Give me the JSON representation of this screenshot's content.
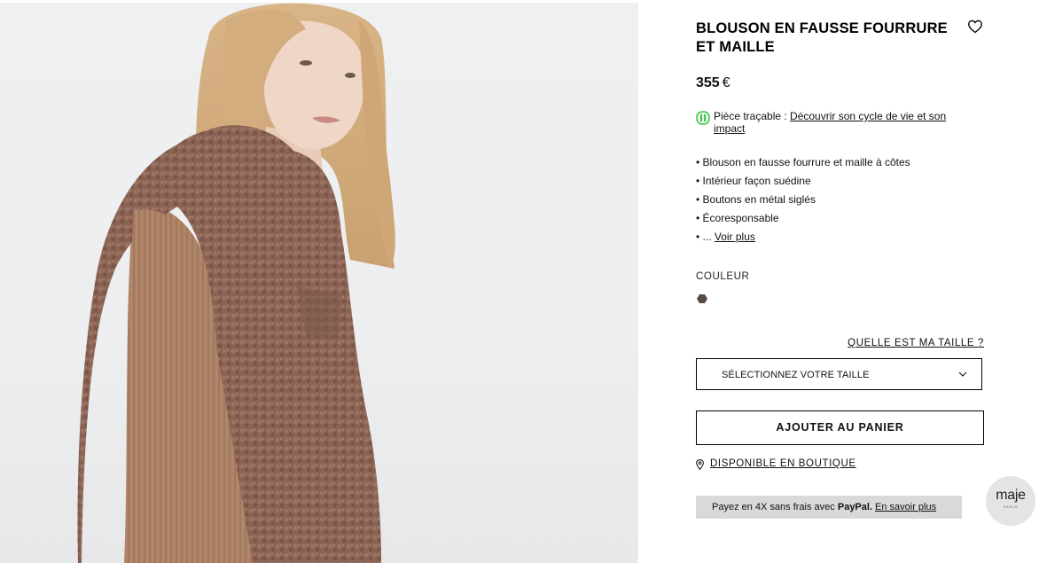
{
  "product": {
    "title": "BLOUSON EN FAUSSE FOURRURE ET MAILLE",
    "price_amount": "355",
    "price_currency": "€",
    "traceability": {
      "label": "Pièce traçable : ",
      "link_text": "Découvrir son cycle de vie et son impact"
    },
    "features": [
      "• Blouson en fausse fourrure et maille à côtes",
      "• Intérieur façon suédine",
      "• Boutons en métal siglés",
      "• Écoresponsable"
    ],
    "more_prefix": "• ... ",
    "more_link": "Voir plus",
    "color_label": "COULEUR",
    "color_swatch": "#5a4a44",
    "size_help": "QUELLE EST MA TAILLE ?",
    "size_select_placeholder": "SÉLECTIONNEZ VOTRE TAILLE",
    "add_to_cart": "AJOUTER AU PANIER",
    "store_availability": "DISPONIBLE EN BOUTIQUE",
    "paypal": {
      "prefix": "Payez en 4X sans frais avec ",
      "brand": "PayPal.",
      "link": "En savoir plus"
    }
  },
  "brand_badge": {
    "name": "maje",
    "sub": "PARIS"
  },
  "icons": {
    "wishlist": "heart-icon",
    "traceability": "traceability-icon",
    "dropdown": "chevron-down-icon",
    "store": "location-pin-icon"
  },
  "colors": {
    "accent_green": "#3cc34a",
    "paypal_bg": "#d9d9d9"
  }
}
